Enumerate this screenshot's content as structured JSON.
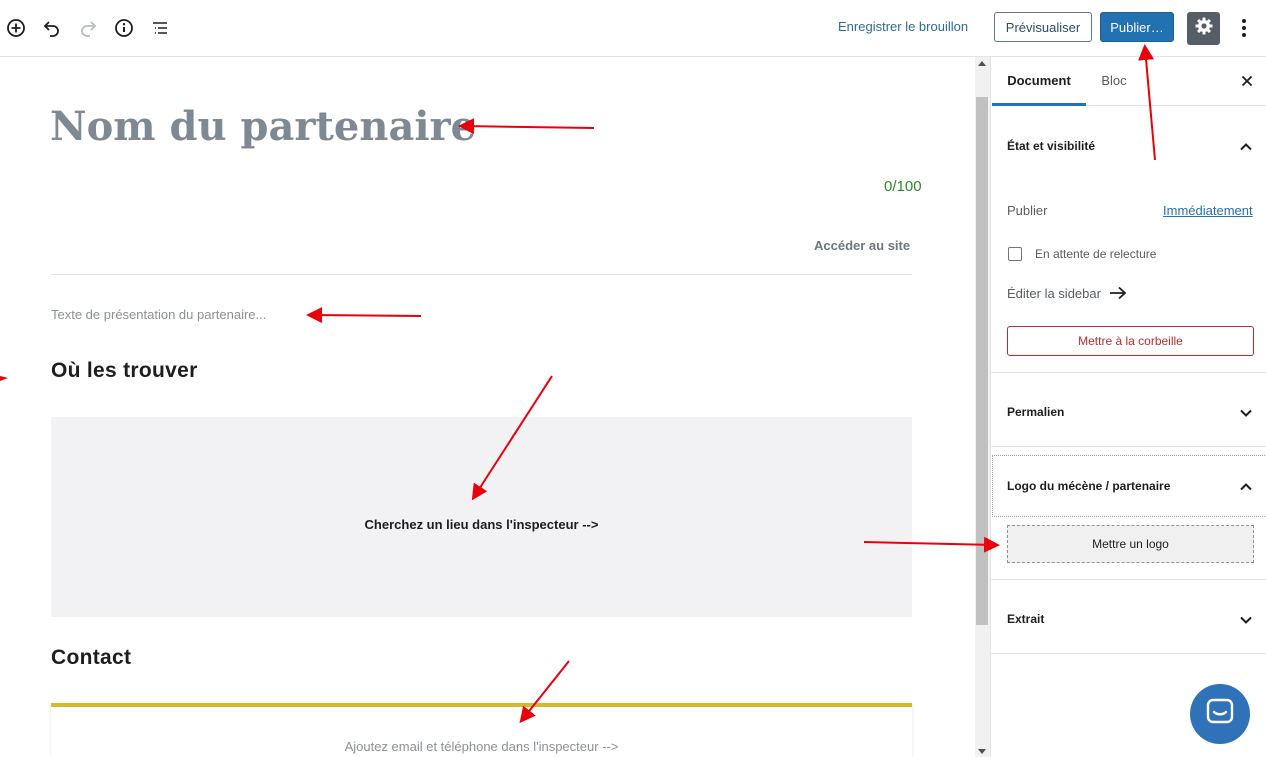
{
  "toolbar": {
    "save_draft": "Enregistrer le brouillon",
    "preview": "Prévisualiser",
    "publish": "Publier…"
  },
  "editor": {
    "title_placeholder": "Nom du partenaire",
    "counter": "0/100",
    "site_link": "Accéder au site",
    "presentation_placeholder": "Texte de présentation du partenaire...",
    "heading_where": "Où les trouver",
    "map_hint": "Cherchez un lieu dans l'inspecteur -->",
    "heading_contact": "Contact",
    "contact_hint": "Ajoutez email et téléphone dans l'inspecteur -->"
  },
  "sidebar": {
    "tabs": [
      {
        "label": "Document",
        "active": true
      },
      {
        "label": "Bloc",
        "active": false
      }
    ],
    "status_panel": {
      "title": "État et visibilité",
      "publish_label": "Publier",
      "publish_value": "Immédiatement",
      "pending_review": "En attente de relecture",
      "edit_sidebar": "Éditer la sidebar",
      "trash": "Mettre à la corbeille"
    },
    "permalink_title": "Permalien",
    "logo_panel": {
      "title": "Logo du mécène / partenaire",
      "button": "Mettre un logo"
    },
    "excerpt_title": "Extrait"
  },
  "colors": {
    "accent": "#2271b1",
    "danger": "#b32d2e",
    "counter": "#2e8b27",
    "contact_border": "#d4b82e",
    "annotation_arrow": "#e8000b"
  },
  "icons": [
    "add-block-icon",
    "undo-icon",
    "redo-icon",
    "info-icon",
    "list-view-icon",
    "gear-icon",
    "more-vertical-icon",
    "close-icon",
    "chevron-up-icon",
    "chevron-down-icon",
    "arrow-right-icon",
    "chat-icon"
  ]
}
